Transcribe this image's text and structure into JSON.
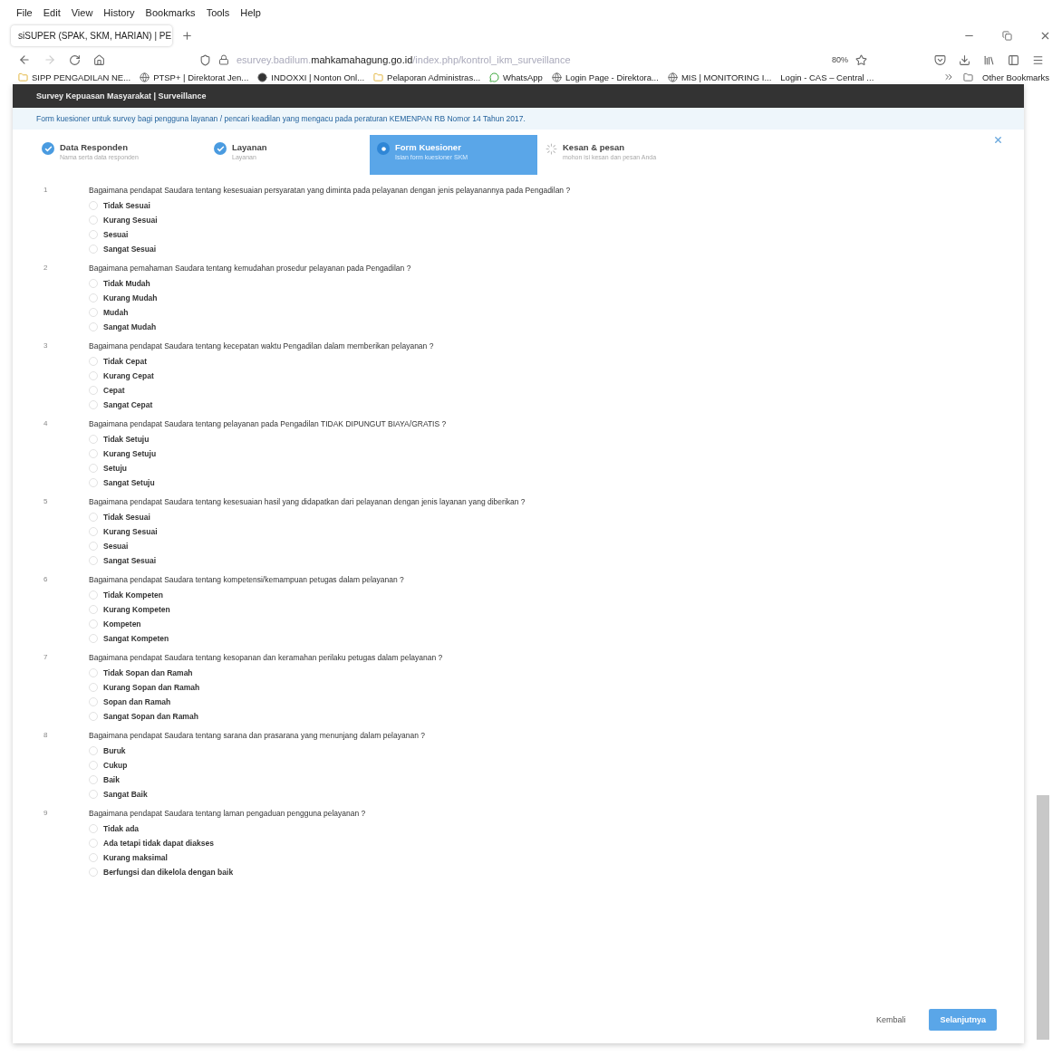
{
  "menu_bar": [
    "File",
    "Edit",
    "View",
    "History",
    "Bookmarks",
    "Tools",
    "Help"
  ],
  "tabs": [
    {
      "label": "siSUPER (SPAK, SKM, HARIAN) | PE",
      "selected": true
    }
  ],
  "address_bar": {
    "url_prefix": "esurvey.badilum.",
    "url_domain": "mahkamahagung.go.id",
    "url_path": "/index.php/kontrol_ikm_surveillance",
    "zoom": "80%"
  },
  "bookmarks": [
    {
      "label": "SIPP PENGADILAN NE...",
      "kind": "folder"
    },
    {
      "label": "PTSP+ | Direktorat Jen...",
      "kind": "globe"
    },
    {
      "label": "INDOXXI | Nonton Onl...",
      "kind": "site"
    },
    {
      "label": "Pelaporan Administras...",
      "kind": "folder"
    },
    {
      "label": "WhatsApp",
      "kind": "chat"
    },
    {
      "label": "Login Page - Direktora...",
      "kind": "globe"
    },
    {
      "label": "MIS | MONITORING I...",
      "kind": "globe"
    },
    {
      "label": "Login - CAS – Central ...",
      "kind": "none"
    }
  ],
  "other_bookmarks": "Other Bookmarks",
  "page": {
    "header": "Survey Kepuasan Masyarakat | Surveillance",
    "info": "Form kuesioner untuk survey bagi pengguna layanan / pencari keadilan yang mengacu pada peraturan KEMENPAN RB Nomor 14 Tahun 2017.",
    "steps": [
      {
        "title": "Data Responden",
        "subtitle": "Nama serta data responden",
        "kind": "done",
        "selected": false
      },
      {
        "title": "Layanan",
        "subtitle": "Layanan",
        "kind": "done",
        "selected": false
      },
      {
        "title": "Form Kuesioner",
        "subtitle": "Isian form kuesioner SKM",
        "kind": "active",
        "selected": true
      },
      {
        "title": "Kesan & pesan",
        "subtitle": "mohon isi kesan dan pesan Anda",
        "kind": "pending",
        "selected": false
      }
    ],
    "questions": [
      {
        "number": "1",
        "text": "Bagaimana pendapat Saudara tentang kesesuaian persyaratan yang diminta pada pelayanan dengan jenis pelayanannya pada Pengadilan ?",
        "options": [
          {
            "label": "Tidak Sesuai",
            "selected": false
          },
          {
            "label": "Kurang Sesuai",
            "selected": false
          },
          {
            "label": "Sesuai",
            "selected": false
          },
          {
            "label": "Sangat Sesuai",
            "selected": false
          }
        ]
      },
      {
        "number": "2",
        "text": "Bagaimana pemahaman Saudara tentang kemudahan prosedur pelayanan pada Pengadilan ?",
        "options": [
          {
            "label": "Tidak Mudah",
            "selected": false
          },
          {
            "label": "Kurang Mudah",
            "selected": false
          },
          {
            "label": "Mudah",
            "selected": false
          },
          {
            "label": "Sangat Mudah",
            "selected": false
          }
        ]
      },
      {
        "number": "3",
        "text": "Bagaimana pendapat Saudara tentang kecepatan waktu Pengadilan dalam memberikan pelayanan ?",
        "options": [
          {
            "label": "Tidak Cepat",
            "selected": false
          },
          {
            "label": "Kurang Cepat",
            "selected": false
          },
          {
            "label": "Cepat",
            "selected": false
          },
          {
            "label": "Sangat Cepat",
            "selected": false
          }
        ]
      },
      {
        "number": "4",
        "text": "Bagaimana pendapat Saudara tentang pelayanan pada Pengadilan TIDAK DIPUNGUT BIAYA/GRATIS ?",
        "options": [
          {
            "label": "Tidak Setuju",
            "selected": false
          },
          {
            "label": "Kurang Setuju",
            "selected": false
          },
          {
            "label": "Setuju",
            "selected": false
          },
          {
            "label": "Sangat Setuju",
            "selected": false
          }
        ]
      },
      {
        "number": "5",
        "text": "Bagaimana pendapat Saudara tentang kesesuaian hasil yang didapatkan dari pelayanan dengan jenis layanan yang diberikan ?",
        "options": [
          {
            "label": "Tidak Sesuai",
            "selected": false
          },
          {
            "label": "Kurang Sesuai",
            "selected": false
          },
          {
            "label": "Sesuai",
            "selected": false
          },
          {
            "label": "Sangat Sesuai",
            "selected": false
          }
        ]
      },
      {
        "number": "6",
        "text": "Bagaimana pendapat Saudara tentang kompetensi/kemampuan petugas dalam pelayanan ?",
        "options": [
          {
            "label": "Tidak Kompeten",
            "selected": false
          },
          {
            "label": "Kurang Kompeten",
            "selected": false
          },
          {
            "label": "Kompeten",
            "selected": false
          },
          {
            "label": "Sangat Kompeten",
            "selected": false
          }
        ]
      },
      {
        "number": "7",
        "text": "Bagaimana pendapat Saudara tentang kesopanan dan keramahan perilaku petugas dalam pelayanan ?",
        "options": [
          {
            "label": "Tidak Sopan dan Ramah",
            "selected": false
          },
          {
            "label": "Kurang Sopan dan Ramah",
            "selected": false
          },
          {
            "label": "Sopan dan Ramah",
            "selected": false
          },
          {
            "label": "Sangat Sopan dan Ramah",
            "selected": false
          }
        ]
      },
      {
        "number": "8",
        "text": "Bagaimana pendapat Saudara tentang sarana dan prasarana yang menunjang dalam pelayanan ?",
        "options": [
          {
            "label": "Buruk",
            "selected": false
          },
          {
            "label": "Cukup",
            "selected": false
          },
          {
            "label": "Baik",
            "selected": false
          },
          {
            "label": "Sangat Baik",
            "selected": false
          }
        ]
      },
      {
        "number": "9",
        "text": "Bagaimana pendapat Saudara tentang laman pengaduan pengguna pelayanan ?",
        "options": [
          {
            "label": "Tidak ada",
            "selected": false
          },
          {
            "label": "Ada tetapi tidak dapat diakses",
            "selected": false
          },
          {
            "label": "Kurang maksimal",
            "selected": false
          },
          {
            "label": "Berfungsi dan dikelola dengan baik",
            "selected": false
          }
        ]
      }
    ],
    "buttons": {
      "back": "Kembali",
      "next": "Selanjutnya"
    }
  }
}
